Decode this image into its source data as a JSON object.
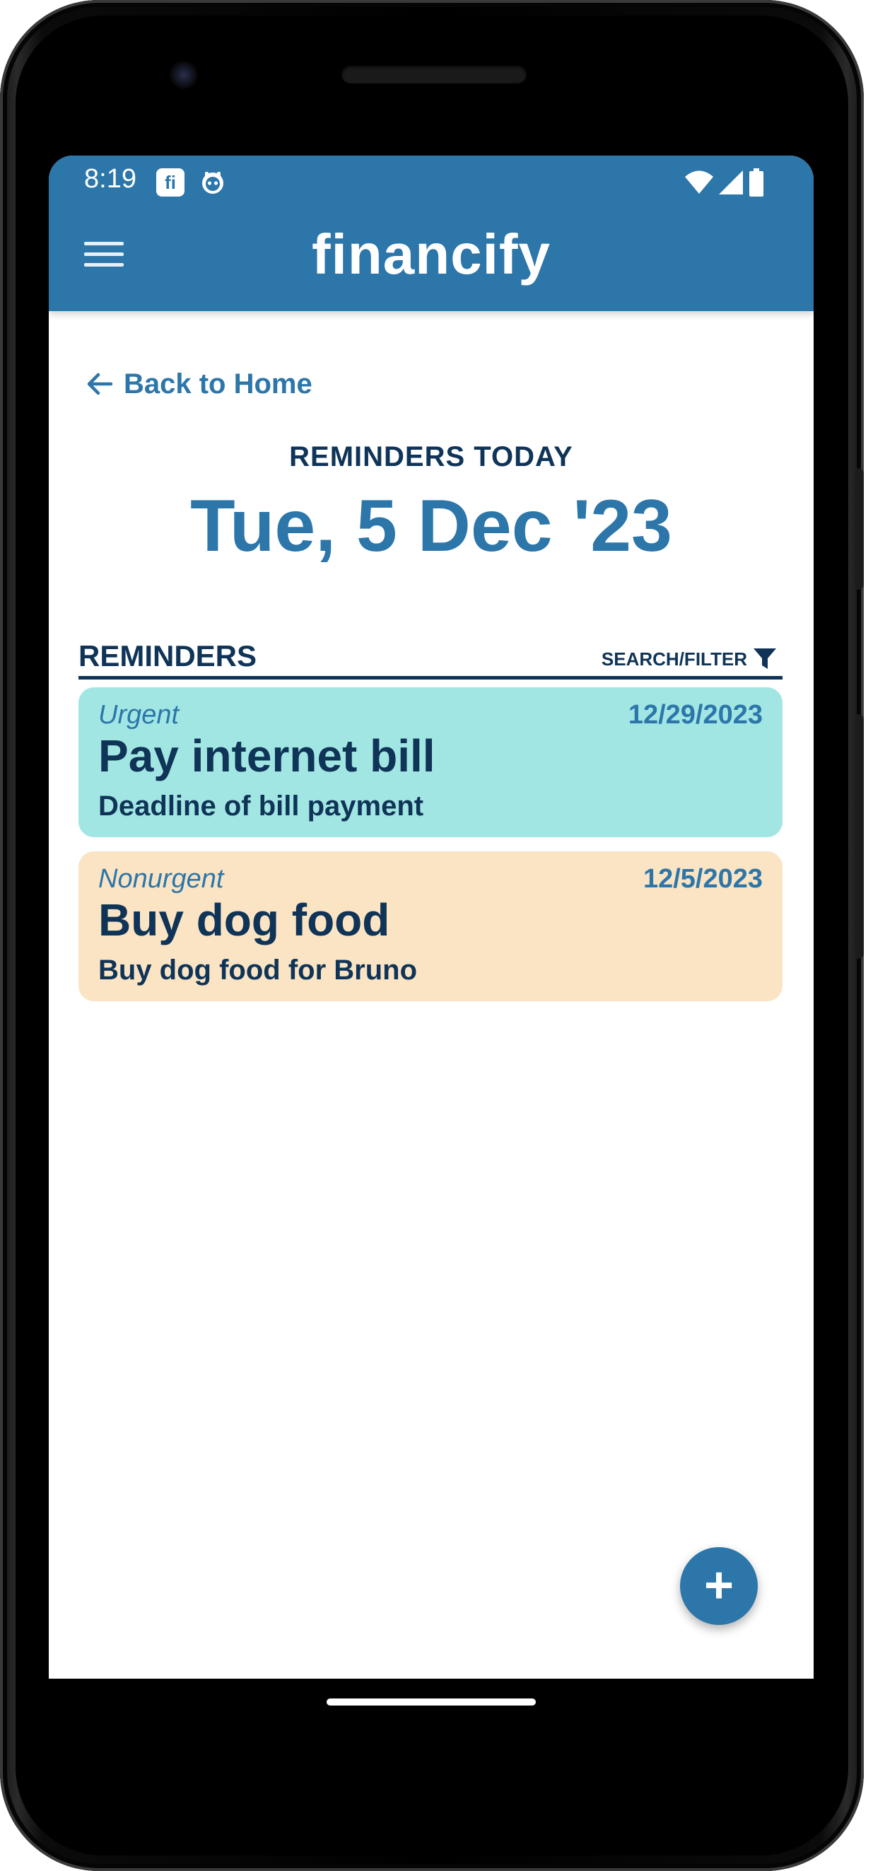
{
  "status_bar": {
    "time": "8:19",
    "notification_icons": [
      "financify-fi-icon",
      "robot-icon"
    ],
    "system_icons": [
      "wifi-icon",
      "cellular-signal-icon",
      "battery-icon"
    ]
  },
  "app_bar": {
    "title": "financify",
    "menu_icon": "menu-icon"
  },
  "navigation": {
    "back_label": "Back to Home",
    "back_icon": "arrow-left-icon"
  },
  "header": {
    "eyebrow": "REMINDERS TODAY",
    "date": "Tue, 5 Dec '23"
  },
  "reminders": {
    "title": "REMINDERS",
    "filter_label": "SEARCH/FILTER",
    "filter_icon": "filter-icon",
    "items": [
      {
        "priority": "Urgent",
        "date": "12/29/2023",
        "title": "Pay internet bill",
        "subtitle": "Deadline of bill payment",
        "color": "#a2e6e3"
      },
      {
        "priority": "Nonurgent",
        "date": "12/5/2023",
        "title": "Buy dog food",
        "subtitle": "Buy dog food for Bruno",
        "color": "#fbe4c4"
      }
    ]
  },
  "fab": {
    "symbol": "+",
    "icon": "add-icon"
  },
  "theme": {
    "primary": "#2c76aa",
    "text_dark": "#0f3457"
  }
}
